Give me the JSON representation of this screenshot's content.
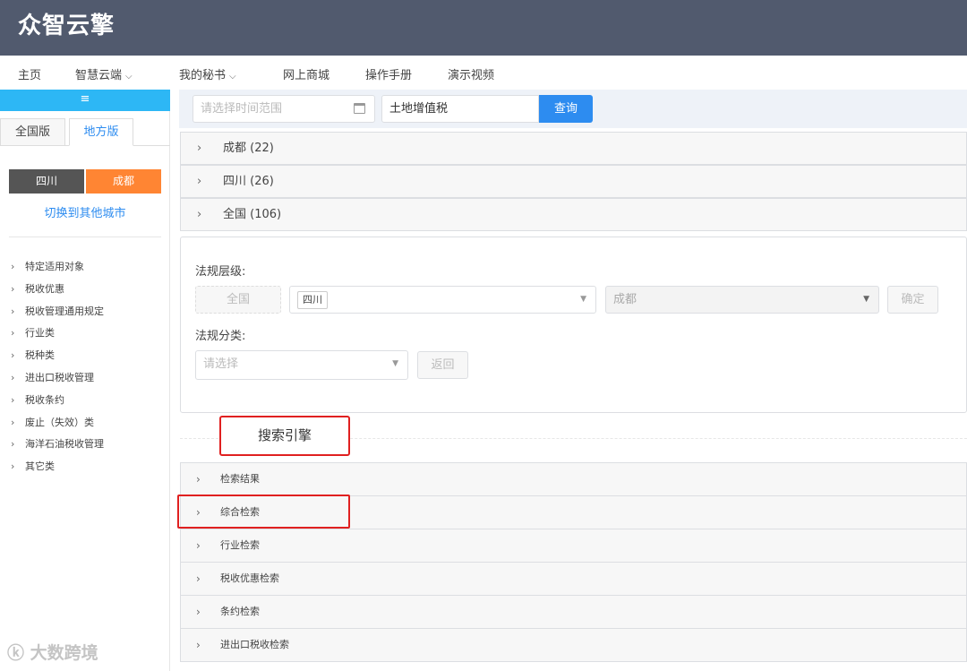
{
  "app": {
    "logo": "众智云擎"
  },
  "nav": {
    "items": [
      {
        "label": "主页",
        "dropdown": false
      },
      {
        "label": "智慧云端",
        "dropdown": true
      },
      {
        "label": "我的秘书",
        "dropdown": true
      },
      {
        "label": "网上商城",
        "dropdown": false
      },
      {
        "label": "操作手册",
        "dropdown": false
      },
      {
        "label": "演示视频",
        "dropdown": false
      }
    ]
  },
  "sidebar": {
    "toggle_icon": "≡",
    "version_tabs": [
      "全国版",
      "地方版"
    ],
    "active_tab": "地方版",
    "province": "四川",
    "city": "成都",
    "switch_city": "切换到其他城市",
    "categories": [
      "特定适用对象",
      "税收优惠",
      "税收管理通用规定",
      "行业类",
      "税种类",
      "进出口税收管理",
      "税收条约",
      "废止（失效）类",
      "海洋石油税收管理",
      "其它类"
    ]
  },
  "search": {
    "date_placeholder": "请选择时间范围",
    "keyword": "土地增值税",
    "query_label": "查询"
  },
  "results": [
    {
      "region": "成都",
      "count": "(22)"
    },
    {
      "region": "四川",
      "count": "(26)"
    },
    {
      "region": "全国",
      "count": "(106)"
    }
  ],
  "filter": {
    "level_label": "法规层级:",
    "nationwide_btn": "全国",
    "province_tag": "四川",
    "city_placeholder": "成都",
    "confirm_label": "确定",
    "category_label": "法规分类:",
    "category_placeholder": "请选择",
    "back_label": "返回"
  },
  "search_engine": {
    "title": "搜索引擎",
    "items": [
      "检索结果",
      "综合检索",
      "行业检索",
      "税收优惠检索",
      "条约检索",
      "进出口税收检索"
    ]
  },
  "watermark": "大数跨境",
  "colors": {
    "topbar": "#515a6e",
    "accent": "#2d8cf0",
    "toggle": "#2db7f5",
    "province": "#555555",
    "city": "#ff8533",
    "highlight": "#e02020"
  }
}
